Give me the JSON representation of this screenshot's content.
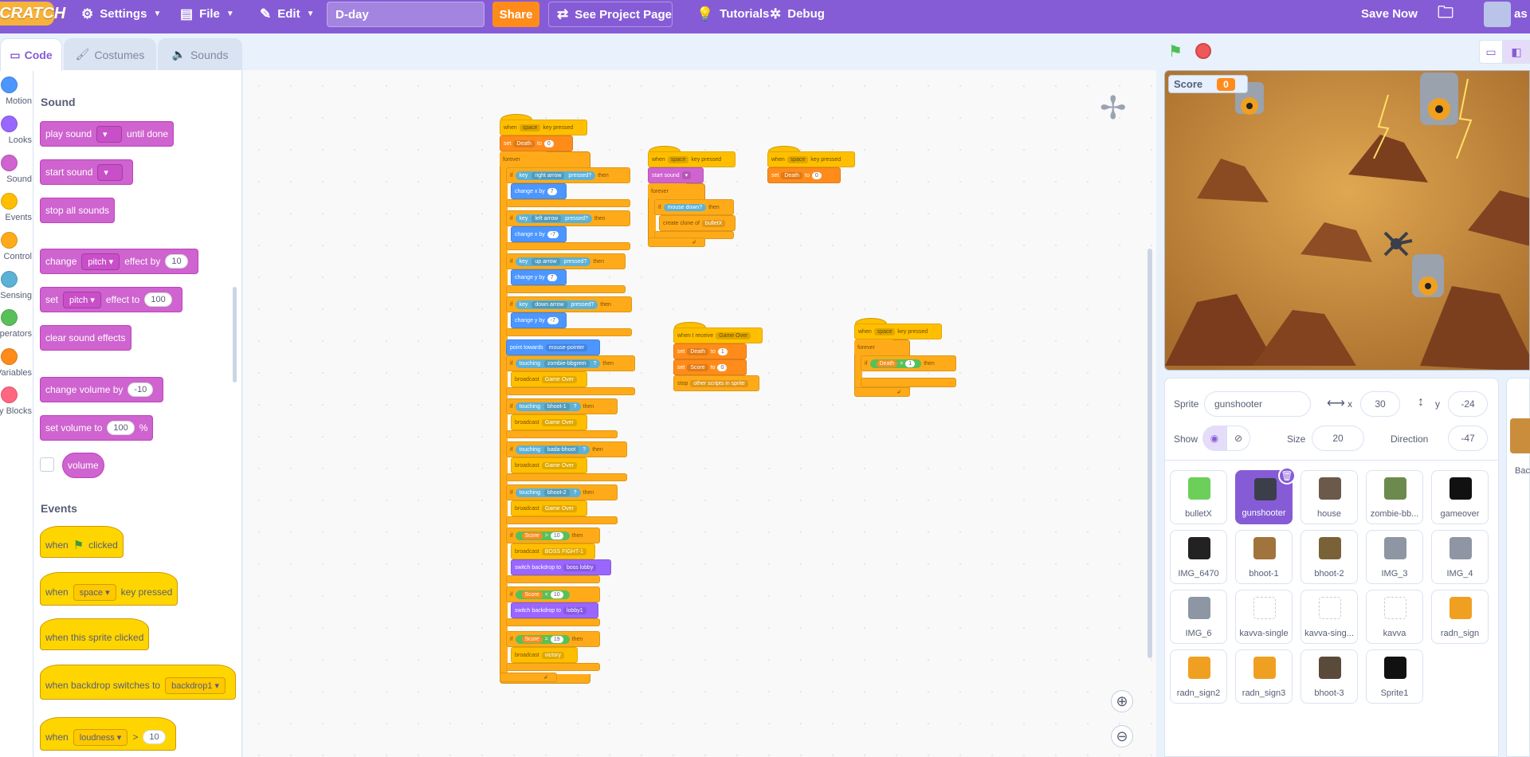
{
  "menu": {
    "logo": "SCRATCH",
    "settings": "Settings",
    "file": "File",
    "edit": "Edit",
    "project_title": "D-day",
    "share": "Share",
    "see_project": "See Project Page",
    "tutorials": "Tutorials",
    "debug": "Debug",
    "save_now": "Save Now",
    "account_partial": "as"
  },
  "tabs": {
    "code": "Code",
    "costumes": "Costumes",
    "sounds": "Sounds"
  },
  "categories": [
    {
      "label": "Motion",
      "color": "#4c97ff"
    },
    {
      "label": "Looks",
      "color": "#9966ff"
    },
    {
      "label": "Sound",
      "color": "#cf63cf"
    },
    {
      "label": "Events",
      "color": "#ffbf00"
    },
    {
      "label": "Control",
      "color": "#ffab19"
    },
    {
      "label": "Sensing",
      "color": "#5cb1d6"
    },
    {
      "label": "Operators",
      "color": "#59c059"
    },
    {
      "label": "Variables",
      "color": "#ff8c1a"
    },
    {
      "label": "My Blocks",
      "color": "#ff6680"
    }
  ],
  "palette": {
    "sound_heading": "Sound",
    "play_sound": "play sound",
    "until_done": "until done",
    "start_sound": "start sound",
    "stop_all_sounds": "stop all sounds",
    "change": "change",
    "pitch": "pitch",
    "effect_by": "effect by",
    "effect_by_val": "10",
    "set": "set",
    "effect_to": "effect to",
    "effect_to_val": "100",
    "clear_sound_effects": "clear sound effects",
    "change_volume_by": "change volume by",
    "change_volume_val": "-10",
    "set_volume_to": "set volume to",
    "set_volume_val": "100",
    "percent": "%",
    "volume": "volume",
    "events_heading": "Events",
    "when": "when",
    "clicked": "clicked",
    "space": "space",
    "key_pressed": "key pressed",
    "when_this_sprite_clicked": "when this sprite clicked",
    "when_backdrop_switches_to": "when backdrop switches to",
    "backdrop1": "backdrop1",
    "loudness": "loudness",
    "gt": ">",
    "loudness_val": "10"
  },
  "scripts": {
    "when": "when",
    "space": "space",
    "key_pressed": "key pressed",
    "set": "set",
    "death": "Death",
    "to": "to",
    "zero": "0",
    "forever": "forever",
    "if": "if",
    "then": "then",
    "key": "key",
    "pressed": "pressed?",
    "right_arrow": "right arrow",
    "left_arrow": "left arrow",
    "up_arrow": "up arrow",
    "down_arrow": "down arrow",
    "change_x_by": "change x by",
    "change_y_by": "change y by",
    "seven": "7",
    "neg_seven": "-7",
    "point_towards": "point towards",
    "mouse_pointer": "mouse-pointer",
    "touching": "touching",
    "q": "?",
    "broadcast": "broadcast",
    "game_over": "Game Over",
    "zombie_bbgrem": "zombie-bbgrem",
    "bhoot_1": "bhoot-1",
    "bada_bhoot": "bada-bhoot",
    "bhoot_2": "bhoot-2",
    "score": "Score",
    "gt": ">",
    "lt": "<",
    "eq": "=",
    "ten": "10",
    "nineteen": "19",
    "boss_fight": "BOSS FIGHT-1",
    "switch_backdrop_to": "switch backdrop to",
    "boss_lobby": "boss lobby",
    "lobby1": "lobby1",
    "victory": "victory",
    "start_sound": "start sound",
    "mouse_down": "mouse down?",
    "create_clone_of": "create clone of",
    "bulletx": "bulletX",
    "when_i_receive": "when I receive",
    "one": "1",
    "stop": "stop",
    "other_scripts": "other scripts in sprite"
  },
  "stage": {
    "score_label": "Score",
    "score_value": "0"
  },
  "sprite_info": {
    "sprite_label": "Sprite",
    "sprite_name": "gunshooter",
    "x_label": "x",
    "x_value": "30",
    "y_label": "y",
    "y_value": "-24",
    "show_label": "Show",
    "size_label": "Size",
    "size_value": "20",
    "direction_label": "Direction",
    "direction_value": "-47"
  },
  "sprites": [
    {
      "name": "bulletX",
      "color": "#6ccf5a"
    },
    {
      "name": "gunshooter",
      "color": "#3a3f4a"
    },
    {
      "name": "house",
      "color": "#6b5a4a"
    },
    {
      "name": "zombie-bb...",
      "color": "#6d8a4e"
    },
    {
      "name": "gameover",
      "color": "#111111"
    },
    {
      "name": "IMG_6470",
      "color": "#222222"
    },
    {
      "name": "bhoot-1",
      "color": "#a0743c"
    },
    {
      "name": "bhoot-2",
      "color": "#7a6238"
    },
    {
      "name": "IMG_3",
      "color": "#8e96a3"
    },
    {
      "name": "IMG_4",
      "color": "#8e96a3"
    },
    {
      "name": "IMG_6",
      "color": "#8e96a3"
    },
    {
      "name": "kavva-single",
      "color": "#ffffff"
    },
    {
      "name": "kavva-sing...",
      "color": "#ffffff"
    },
    {
      "name": "kavva",
      "color": "#ffffff"
    },
    {
      "name": "radn_sign",
      "color": "#f0a020"
    },
    {
      "name": "radn_sign2",
      "color": "#f0a020"
    },
    {
      "name": "radn_sign3",
      "color": "#f0a020"
    },
    {
      "name": "bhoot-3",
      "color": "#5a4a3a"
    },
    {
      "name": "Sprite1",
      "color": "#111111"
    }
  ],
  "backdrop_pane": {
    "label_partial": "Bac"
  }
}
